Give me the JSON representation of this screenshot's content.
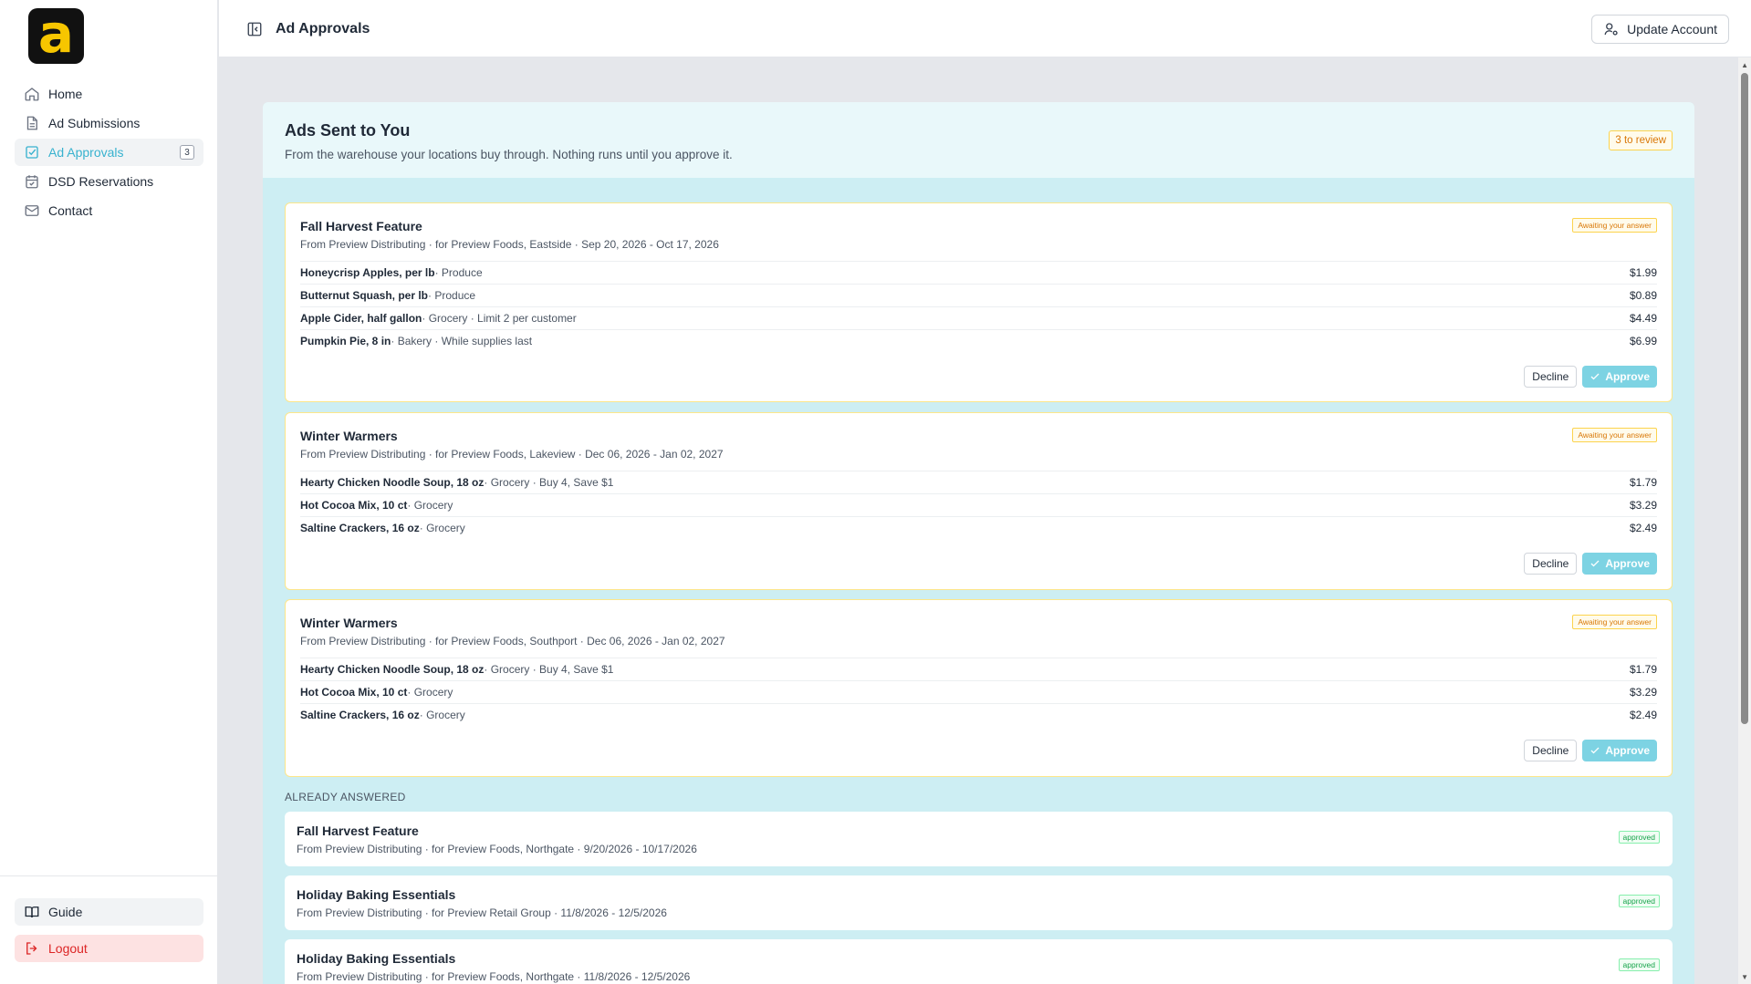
{
  "app": {
    "logo_letter": "a",
    "brand_color": "#f7c600",
    "accent_color": "#38b2cf"
  },
  "sidebar": {
    "items": [
      {
        "label": "Home",
        "icon": "home-icon"
      },
      {
        "label": "Ad Submissions",
        "icon": "document-icon"
      },
      {
        "label": "Ad Approvals",
        "icon": "checkbox-icon",
        "badge": "3",
        "active": true
      },
      {
        "label": "DSD Reservations",
        "icon": "calendar-icon"
      },
      {
        "label": "Contact",
        "icon": "mail-icon"
      }
    ],
    "guide_label": "Guide",
    "logout_label": "Logout"
  },
  "header": {
    "title": "Ad Approvals",
    "update_account_label": "Update Account"
  },
  "main": {
    "title": "Ads Sent to You",
    "subtitle": "From the warehouse your locations buy through. Nothing runs until you approve it.",
    "review_badge": "3 to review",
    "pending": [
      {
        "title": "Fall Harvest Feature",
        "meta": "From Preview Distributing · for Preview Foods, Eastside · Sep 20, 2026 - Oct 17, 2026",
        "status": "Awaiting your answer",
        "items": [
          {
            "name": "Honeycrisp Apples, per lb",
            "details": " · Produce",
            "price": "$1.99"
          },
          {
            "name": "Butternut Squash, per lb",
            "details": " · Produce",
            "price": "$0.89"
          },
          {
            "name": "Apple Cider, half gallon",
            "details": " · Grocery · Limit 2 per customer",
            "price": "$4.49"
          },
          {
            "name": "Pumpkin Pie, 8 in",
            "details": " · Bakery · While supplies last",
            "price": "$6.99"
          }
        ],
        "decline_label": "Decline",
        "approve_label": "Approve"
      },
      {
        "title": "Winter Warmers",
        "meta": "From Preview Distributing · for Preview Foods, Lakeview · Dec 06, 2026 - Jan 02, 2027",
        "status": "Awaiting your answer",
        "items": [
          {
            "name": "Hearty Chicken Noodle Soup, 18 oz",
            "details": " · Grocery · Buy 4, Save $1",
            "price": "$1.79"
          },
          {
            "name": "Hot Cocoa Mix, 10 ct",
            "details": " · Grocery",
            "price": "$3.29"
          },
          {
            "name": "Saltine Crackers, 16 oz",
            "details": " · Grocery",
            "price": "$2.49"
          }
        ],
        "decline_label": "Decline",
        "approve_label": "Approve"
      },
      {
        "title": "Winter Warmers",
        "meta": "From Preview Distributing · for Preview Foods, Southport · Dec 06, 2026 - Jan 02, 2027",
        "status": "Awaiting your answer",
        "items": [
          {
            "name": "Hearty Chicken Noodle Soup, 18 oz",
            "details": " · Grocery · Buy 4, Save $1",
            "price": "$1.79"
          },
          {
            "name": "Hot Cocoa Mix, 10 ct",
            "details": " · Grocery",
            "price": "$3.29"
          },
          {
            "name": "Saltine Crackers, 16 oz",
            "details": " · Grocery",
            "price": "$2.49"
          }
        ],
        "decline_label": "Decline",
        "approve_label": "Approve"
      }
    ],
    "answered_label": "ALREADY ANSWERED",
    "answered": [
      {
        "title": "Fall Harvest Feature",
        "meta": "From Preview Distributing · for Preview Foods, Northgate · 9/20/2026 - 10/17/2026",
        "status": "approved"
      },
      {
        "title": "Holiday Baking Essentials",
        "meta": "From Preview Distributing · for Preview Retail Group · 11/8/2026 - 12/5/2026",
        "status": "approved"
      },
      {
        "title": "Holiday Baking Essentials",
        "meta": "From Preview Distributing · for Preview Foods, Northgate · 11/8/2026 - 12/5/2026",
        "status": "approved"
      }
    ]
  }
}
